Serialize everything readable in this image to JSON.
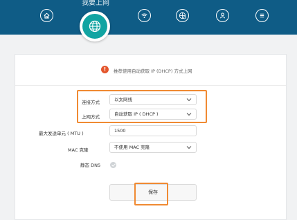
{
  "header": {
    "title": "我要上网",
    "nav_icons": [
      "home-icon",
      "globe-icon",
      "wifi-icon",
      "settings-globe-icon",
      "user-icon",
      "menu-icon"
    ]
  },
  "notice": {
    "icon": "!",
    "text": "推荐使用自动获取 IP (DHCP) 方式上网"
  },
  "form": {
    "connection_type": {
      "label": "连接方式",
      "value": "以太网线"
    },
    "internet_mode": {
      "label": "上网方式",
      "value": "自动获取 IP ( DHCP )"
    },
    "mtu": {
      "label": "最大发送单元 ( MTU )",
      "value": "1500"
    },
    "mac_clone": {
      "label": "MAC 克隆",
      "value": "不使用 MAC 克隆"
    },
    "static_dns": {
      "label": "静态 DNS"
    }
  },
  "actions": {
    "save_label": "保存"
  },
  "colors": {
    "header_bg": "#0f5c86",
    "active_nav": "#11a4a2",
    "highlight": "#f08a32",
    "notice": "#e4562d"
  }
}
